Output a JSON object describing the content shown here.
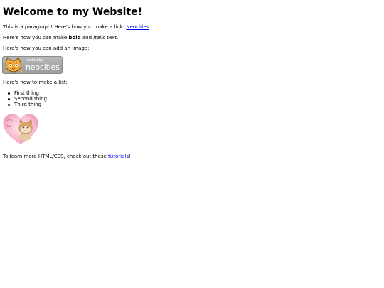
{
  "heading": "Welcome to my Website!",
  "paragraph1": {
    "text": "This is a paragraph! Here's how you make a link: ",
    "link": "Neocities",
    "end": "."
  },
  "paragraph2": {
    "pre": "Here's how you can make ",
    "bold": "bold",
    "mid": " and ",
    "italic": "italic",
    "end": " text."
  },
  "paragraph3": "Here's how you can add an image:",
  "badge": {
    "hosted": "hosted by",
    "brand": "neocities",
    "icon": "neocities-cat-icon"
  },
  "paragraph4": "Here's how to make a list:",
  "list": [
    "First thing",
    "Second thing",
    "Third thing"
  ],
  "heart_image": "heart-kitten-image",
  "footer": {
    "text": "To learn more HTML/CSS, check out these ",
    "link": "tutorials",
    "end": "!"
  }
}
